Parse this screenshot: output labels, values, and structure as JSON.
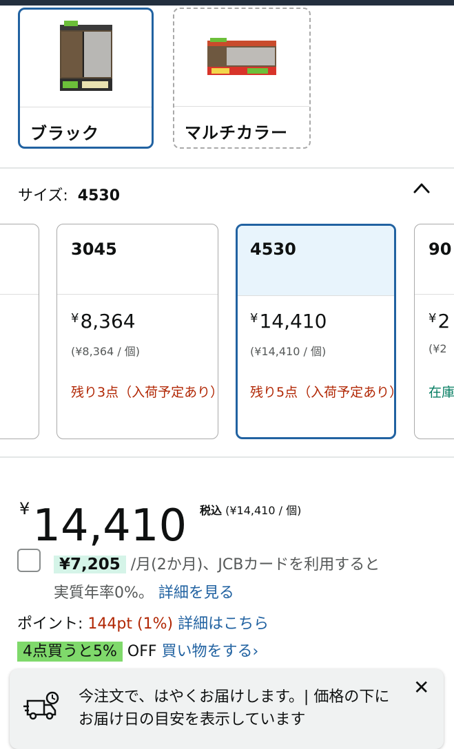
{
  "colors": {
    "selected_border": "#2162a1",
    "selected_fill": "#e8f4fc",
    "price_red": "#b12704",
    "link_blue": "#2162a1",
    "in_stock_green": "#067d62",
    "installment_highlight": "#d5f4e8",
    "promo_badge": "#7fd96b"
  },
  "color_options": [
    {
      "label": "ブラック",
      "state": "selected"
    },
    {
      "label": "マルチカラー",
      "state": "unavailable"
    }
  ],
  "size": {
    "label": "サイズ:",
    "selected": "4530",
    "collapse_icon": "chevron-up-icon"
  },
  "size_options": [
    {
      "name": "3045",
      "price": "8,364",
      "yen": "¥",
      "unit_price": "(¥8,364 / 個)",
      "stock": "残り3点（入荷予定あり）"
    },
    {
      "name": "4530",
      "price": "14,410",
      "yen": "¥",
      "unit_price": "(¥14,410 / 個)",
      "stock": "残り5点（入荷予定あり）"
    },
    {
      "name": "90",
      "price": "2",
      "yen": "¥",
      "unit_price": "(¥2",
      "stock": "在庫"
    }
  ],
  "price": {
    "yen": "¥",
    "amount": "14,410",
    "tax_label": "税込",
    "unit": "(¥14,410 / 個)"
  },
  "installment": {
    "amount": "¥7,205",
    "text": "/月(2か月)、JCBカードを利用すると",
    "text2": "実質年率0%。",
    "link": "詳細を見る"
  },
  "points": {
    "label": "ポイント:",
    "value": "144pt",
    "percent": "(1%)",
    "link": "詳細はこちら"
  },
  "promo": {
    "badge": "4点買うと5%",
    "off": "OFF",
    "link": "買い物をする›"
  },
  "toast": {
    "icon": "delivery-truck-clock-icon",
    "message": "今注文で、はやくお届けします。| 価格の下にお届け日の目安を表示しています",
    "close": "✕"
  }
}
